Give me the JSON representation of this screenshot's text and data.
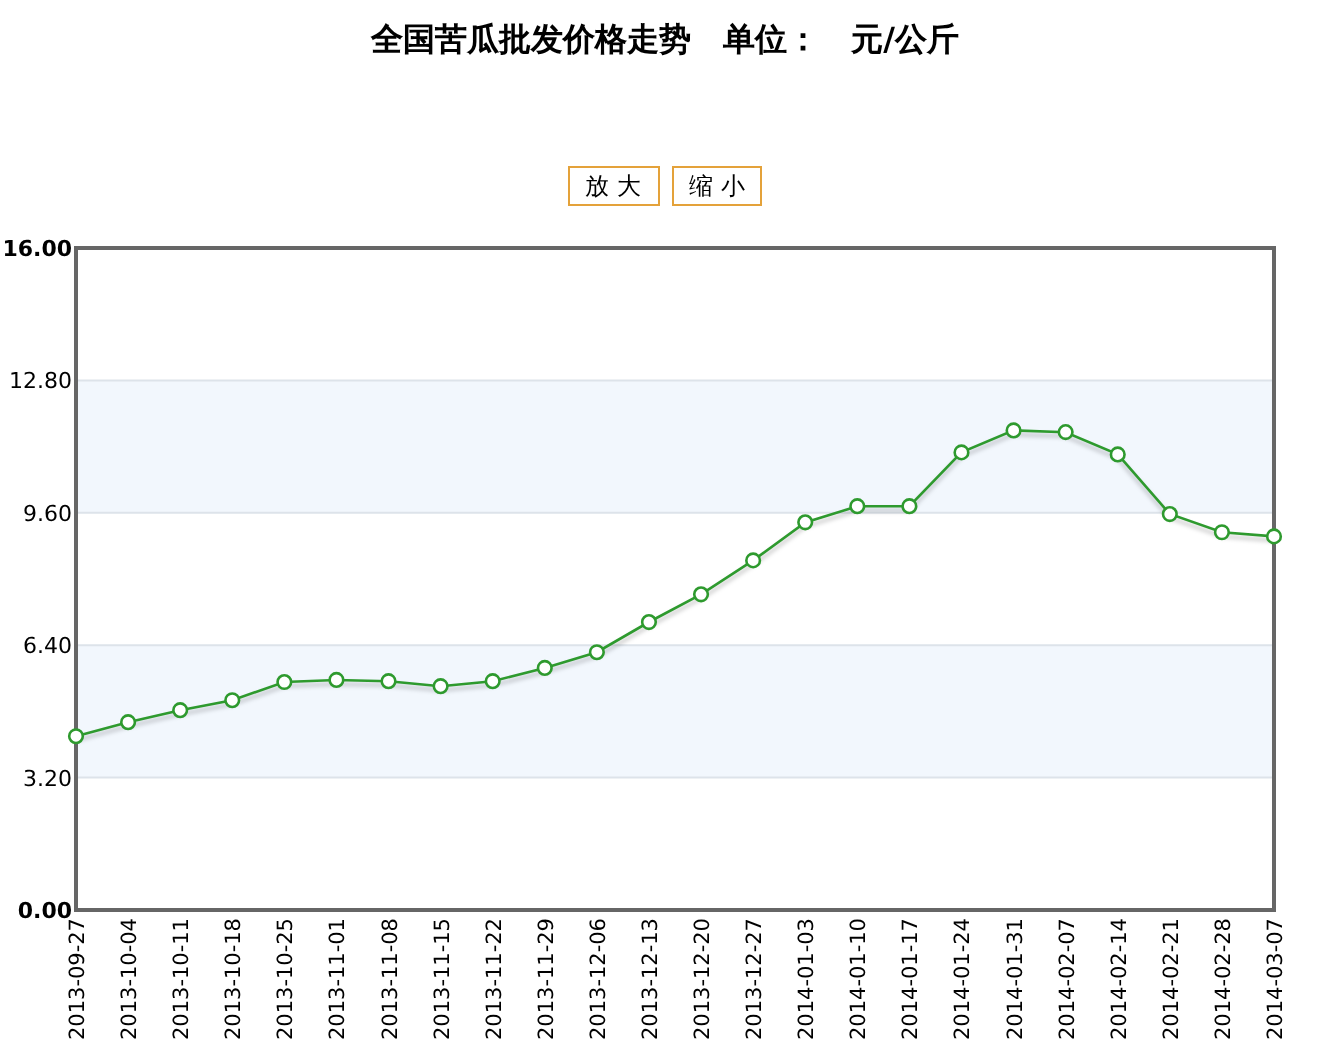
{
  "title": "全国苦瓜批发价格走势　单位：　元/公斤",
  "buttons": [
    {
      "label": "放 大"
    },
    {
      "label": "缩 小"
    }
  ],
  "chart": {
    "chart_data": {
      "type": "line",
      "categories": [
        "2013-09-27",
        "2013-10-04",
        "2013-10-11",
        "2013-10-18",
        "2013-10-25",
        "2013-11-01",
        "2013-11-08",
        "2013-11-15",
        "2013-11-22",
        "2013-11-29",
        "2013-12-06",
        "2013-12-13",
        "2013-12-20",
        "2013-12-27",
        "2014-01-03",
        "2014-01-10",
        "2014-01-17",
        "2014-01-24",
        "2014-01-31",
        "2014-02-07",
        "2014-02-14",
        "2014-02-21",
        "2014-02-28",
        "2014-03-07"
      ],
      "grid": true,
      "series": [
        {
          "color": "#2e9a2e",
          "marker": "circle",
          "values": [
            4.2,
            4.54,
            4.83,
            5.07,
            5.51,
            5.56,
            5.53,
            5.41,
            5.53,
            5.85,
            6.23,
            6.96,
            7.63,
            8.45,
            9.37,
            9.76,
            9.76,
            11.06,
            11.59,
            11.55,
            11.01,
            9.57,
            9.13,
            9.03
          ]
        }
      ],
      "ylim": [
        0,
        16
      ],
      "yticks": [
        {
          "value": 0,
          "label": "0.00"
        },
        {
          "value": 3.2,
          "label": "3.20"
        },
        {
          "value": 6.4,
          "label": "6.40"
        },
        {
          "value": 9.6,
          "label": "9.60"
        },
        {
          "value": 12.8,
          "label": "12.80"
        },
        {
          "value": 16,
          "label": "16.00"
        }
      ]
    }
  }
}
